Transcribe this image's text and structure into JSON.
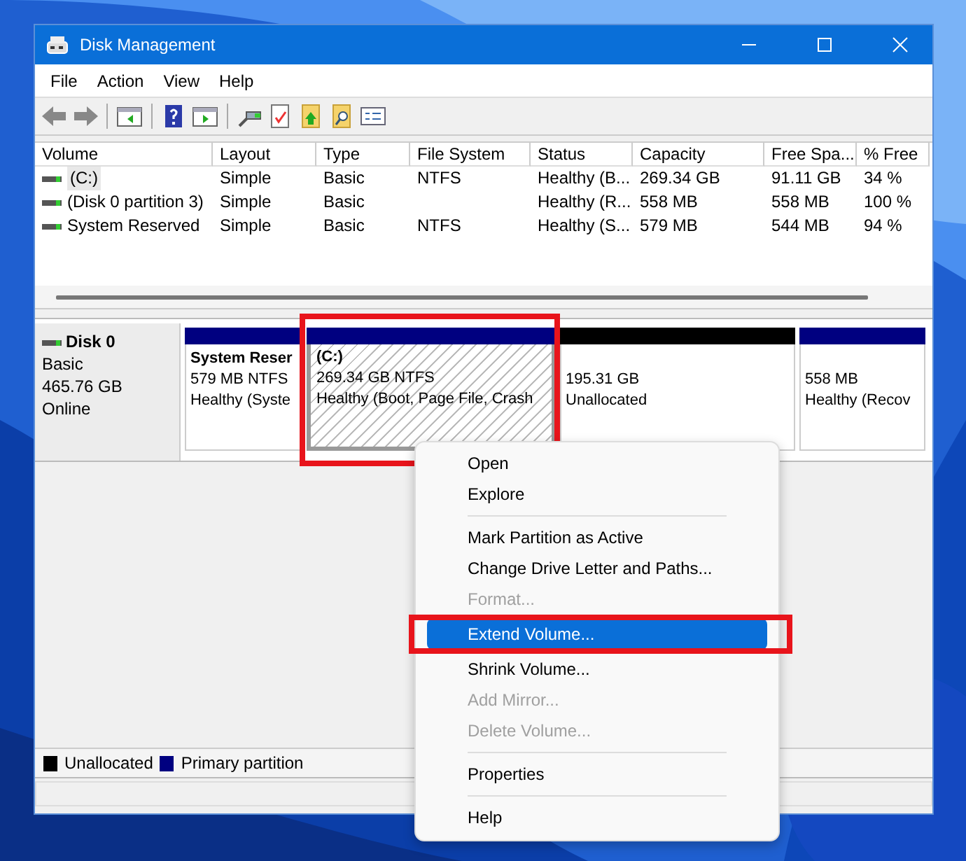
{
  "window": {
    "title": "Disk Management"
  },
  "menu_bar": [
    "File",
    "Action",
    "View",
    "Help"
  ],
  "volume_table": {
    "columns": [
      "Volume",
      "Layout",
      "Type",
      "File System",
      "Status",
      "Capacity",
      "Free Spa...",
      "% Free"
    ],
    "rows": [
      {
        "selected": true,
        "cells": [
          "(C:)",
          "Simple",
          "Basic",
          "NTFS",
          "Healthy (B...",
          "269.34 GB",
          "91.11 GB",
          "34 %"
        ]
      },
      {
        "selected": false,
        "cells": [
          "(Disk 0 partition 3)",
          "Simple",
          "Basic",
          "",
          "Healthy (R...",
          "558 MB",
          "558 MB",
          "100 %"
        ]
      },
      {
        "selected": false,
        "cells": [
          "System Reserved",
          "Simple",
          "Basic",
          "NTFS",
          "Healthy (S...",
          "579 MB",
          "544 MB",
          "94 %"
        ]
      }
    ]
  },
  "disks": [
    {
      "name": "Disk 0",
      "type": "Basic",
      "size": "465.76 GB",
      "status": "Online",
      "partitions": [
        {
          "kind": "primary",
          "name": "System Reser",
          "size": "579 MB NTFS",
          "status": "Healthy (Syste",
          "selected": false,
          "highlighted": false
        },
        {
          "kind": "primary",
          "name": "(C:)",
          "size": "269.34 GB NTFS",
          "status": "Healthy (Boot, Page File, Crash",
          "selected": true,
          "highlighted": true
        },
        {
          "kind": "unallocated",
          "size": "195.31 GB",
          "status": "Unallocated",
          "selected": false,
          "highlighted": false
        },
        {
          "kind": "primary",
          "size": "558 MB",
          "status": "Healthy (Recov",
          "selected": false,
          "highlighted": false
        }
      ]
    }
  ],
  "legend": [
    {
      "label": "Unallocated",
      "color": "#000000"
    },
    {
      "label": "Primary partition",
      "color": "#000080"
    }
  ],
  "context_menu": [
    {
      "kind": "item",
      "label": "Open",
      "disabled": false,
      "selected": false,
      "highlighted": false
    },
    {
      "kind": "item",
      "label": "Explore",
      "disabled": false,
      "selected": false,
      "highlighted": false
    },
    {
      "kind": "separator"
    },
    {
      "kind": "item",
      "label": "Mark Partition as Active",
      "disabled": false,
      "selected": false,
      "highlighted": false
    },
    {
      "kind": "item",
      "label": "Change Drive Letter and Paths...",
      "disabled": false,
      "selected": false,
      "highlighted": false
    },
    {
      "kind": "item",
      "label": "Format...",
      "disabled": true,
      "selected": false,
      "highlighted": false
    },
    {
      "kind": "item",
      "label": "Extend Volume...",
      "disabled": false,
      "selected": true,
      "highlighted": true
    },
    {
      "kind": "item",
      "label": "Shrink Volume...",
      "disabled": false,
      "selected": false,
      "highlighted": false
    },
    {
      "kind": "item",
      "label": "Add Mirror...",
      "disabled": true,
      "selected": false,
      "highlighted": false
    },
    {
      "kind": "item",
      "label": "Delete Volume...",
      "disabled": true,
      "selected": false,
      "highlighted": false
    },
    {
      "kind": "separator"
    },
    {
      "kind": "item",
      "label": "Properties",
      "disabled": false,
      "selected": false,
      "highlighted": false
    },
    {
      "kind": "separator"
    },
    {
      "kind": "item",
      "label": "Help",
      "disabled": false,
      "selected": false,
      "highlighted": false
    }
  ]
}
